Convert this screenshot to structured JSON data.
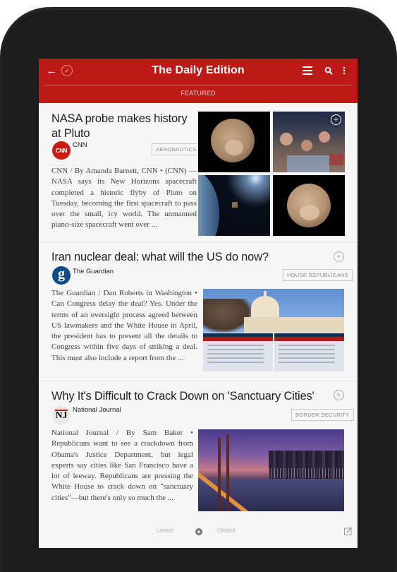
{
  "app": {
    "title": "The Daily Edition",
    "section": "FEATURED",
    "icons": {
      "back": "arrow-left-icon",
      "check": "check-circle-icon",
      "menu": "hamburger-menu-icon",
      "search": "search-icon",
      "more": "more-vertical-icon"
    },
    "colors": {
      "accent": "#bd1a17",
      "background": "#f6f6f6",
      "bezel": "#1c1c1c"
    }
  },
  "articles": [
    {
      "title_line1": "NASA probe makes history",
      "title_line2": "at Pluto",
      "source": "CNN",
      "source_logo_text": "CNN",
      "tag": "AERONAUTICS",
      "body": "CNN / By Amanda Barnett, CNN • (CNN) — NASA says its New Horizons spacecraft completed a historic flyby of Pluto on Tuesday, becoming the first spacecraft to pass over the small, icy world. The unmanned piano-size spacecraft went over ...",
      "images": [
        "Pluto photo",
        "Mission control crowd celebrating",
        "Spacecraft over Earth",
        "Pluto close-up"
      ]
    },
    {
      "title": "Iran nuclear deal: what will the US do now?",
      "source": "The Guardian",
      "source_logo_text": "g",
      "tag": "HOUSE REPUBLICANS",
      "body": "The Guardian / Dan Roberts in Washington • Can Congress delay the deal? Yes. Under the terms of an oversight process agreed between US lawmakers and the White House in April, the president has to present all the details to Congress within five days of striking a deal. This must also include a report from the ...",
      "images": [
        "US Capitol building",
        "Iran deal infographic",
        "Iran deal infographic"
      ]
    },
    {
      "title": "Why It's Difficult to Crack Down on 'Sanctuary Cities'",
      "source": "National Journal",
      "source_logo_text": "NJ",
      "tag": "BORDER SECURITY",
      "body": "National Journal / By Sam Baker • Republicans want to see a crackdown from Obama's Justice Department, but legal experts say cities like San Francisco have a lot of leeway. Republicans are pressing the White House to crack down on \"sanctuary cities\"—but there's only so much the ...",
      "images": [
        "San Francisco Bay Bridge at dusk"
      ]
    }
  ],
  "footer": {
    "latest": "Latest",
    "oldest": "Oldest",
    "edit_icon": "edit-icon"
  }
}
